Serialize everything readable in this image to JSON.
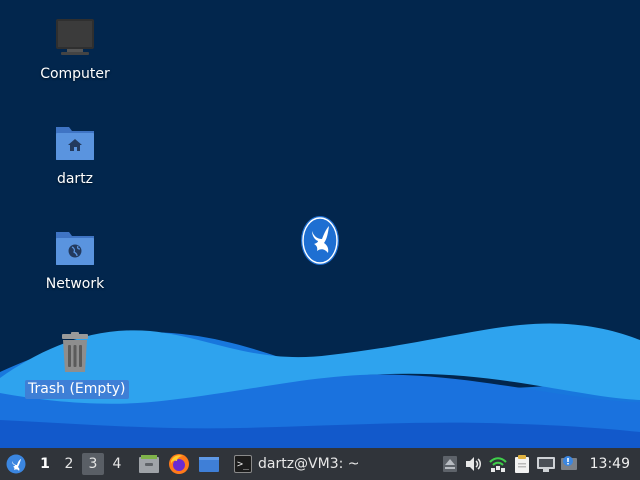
{
  "desktop": {
    "background_color": "#02264d",
    "icons": [
      {
        "label": "Computer"
      },
      {
        "label": "dartz"
      },
      {
        "label": "Network"
      },
      {
        "label": "Trash (Empty)"
      }
    ]
  },
  "panel": {
    "workspaces": [
      "1",
      "2",
      "3",
      "4"
    ],
    "current_workspace": "1",
    "active_workspace": "3",
    "launchers": [
      "file-manager-icon",
      "firefox-icon",
      "show-desktop-icon"
    ],
    "task_window": {
      "label": "dartz@VM3: ~",
      "icon": "terminal-icon"
    },
    "tray_icons": [
      "eject-icon",
      "volume-icon",
      "network-wifi-icon",
      "clipboard-icon",
      "wired-network-icon",
      "notification-icon"
    ],
    "clock": "13:49"
  },
  "colors": {
    "wave_light": "#2ea3ee",
    "wave_mid": "#1d86e4",
    "wave_dark": "#1257c9",
    "panel": "#30343a",
    "selection": "#3e7fd6",
    "folder": "#5a94df"
  }
}
